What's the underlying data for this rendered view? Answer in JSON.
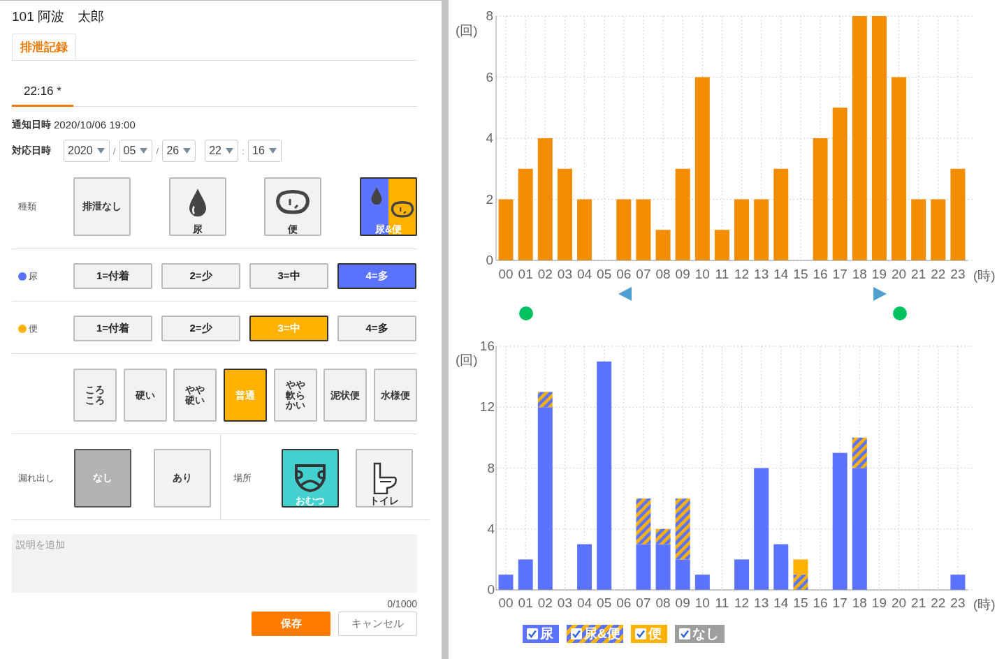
{
  "header": {
    "title": "101  阿波　太郎"
  },
  "tabs": [
    {
      "label": "排泄記録",
      "selected": true
    }
  ],
  "record_tabs": [
    {
      "label": "22:16 *",
      "selected": true
    }
  ],
  "notified": {
    "label": "通知日時",
    "value": "2020/10/06 19:00"
  },
  "handled": {
    "label": "対応日時",
    "selects": [
      {
        "value": "2020"
      },
      {
        "sep": "/",
        "value": "05"
      },
      {
        "sep": "/",
        "value": "26"
      },
      {
        "value": "22"
      },
      {
        "sep": ":",
        "value": "16"
      }
    ]
  },
  "type": {
    "label": "種類",
    "options": [
      {
        "label": "排泄なし",
        "kind": "none",
        "selected": false
      },
      {
        "label": "尿",
        "kind": "urine",
        "selected": false
      },
      {
        "label": "便",
        "kind": "stool",
        "selected": false
      },
      {
        "label": "尿&便",
        "kind": "both",
        "selected": true
      }
    ]
  },
  "urine": {
    "label": "尿",
    "color": "#5b73ff",
    "options": [
      {
        "label": "1=付着",
        "selected": false
      },
      {
        "label": "2=少",
        "selected": false
      },
      {
        "label": "3=中",
        "selected": false
      },
      {
        "label": "4=多",
        "selected": true
      }
    ]
  },
  "stool": {
    "label": "便",
    "color": "#ffb300",
    "options": [
      {
        "label": "1=付着",
        "selected": false
      },
      {
        "label": "2=少",
        "selected": false
      },
      {
        "label": "3=中",
        "selected": true
      },
      {
        "label": "4=多",
        "selected": false
      }
    ]
  },
  "consistency": {
    "options": [
      {
        "label": "ころころ",
        "selected": false
      },
      {
        "label": "硬い",
        "selected": false
      },
      {
        "label": "やや硬い",
        "selected": false
      },
      {
        "label": "普通",
        "selected": true
      },
      {
        "label": "やや軟らかい",
        "selected": false
      },
      {
        "label": "泥状便",
        "selected": false
      },
      {
        "label": "水様便",
        "selected": false
      }
    ]
  },
  "leak": {
    "label": "漏れ出し",
    "options": [
      {
        "label": "なし",
        "selected": true
      },
      {
        "label": "あり",
        "selected": false
      }
    ]
  },
  "place": {
    "label": "場所",
    "options": [
      {
        "label": "おむつ",
        "kind": "diaper",
        "selected": true
      },
      {
        "label": "トイレ",
        "kind": "toilet",
        "selected": false
      }
    ]
  },
  "note": {
    "placeholder": "説明を追加",
    "counter": "0/1000"
  },
  "buttons": [
    {
      "label": "保存",
      "kind": "primary"
    },
    {
      "label": "キャンセル",
      "kind": "secondary"
    }
  ],
  "hourly_chart": {
    "chart_data": {
      "type": "bar",
      "xlabel": "(時)",
      "ylabel": "(回)",
      "categories": [
        "00",
        "01",
        "02",
        "03",
        "04",
        "05",
        "06",
        "07",
        "08",
        "09",
        "10",
        "11",
        "12",
        "13",
        "14",
        "15",
        "16",
        "17",
        "18",
        "19",
        "20",
        "21",
        "22",
        "23"
      ],
      "series": [
        {
          "color": "#f28c00",
          "values": [
            2,
            3,
            4,
            3,
            2,
            0,
            2,
            2,
            1,
            3,
            6,
            1,
            2,
            2,
            3,
            0,
            4,
            5,
            8,
            8,
            6,
            2,
            2,
            3
          ]
        }
      ],
      "ylim": [
        0,
        8
      ],
      "yticks": [
        0,
        2,
        4,
        6,
        8
      ],
      "grid": true
    }
  },
  "type_chart": {
    "chart_data": {
      "type": "bar",
      "stacked": true,
      "xlabel": "(時)",
      "ylabel": "(回)",
      "categories": [
        "00",
        "01",
        "02",
        "03",
        "04",
        "05",
        "06",
        "07",
        "08",
        "09",
        "10",
        "11",
        "12",
        "13",
        "14",
        "15",
        "16",
        "17",
        "18",
        "19",
        "20",
        "21",
        "22",
        "23"
      ],
      "series": [
        {
          "name": "尿",
          "color": "#5b73ff",
          "values": [
            1,
            2,
            12,
            0,
            3,
            15,
            0,
            3,
            3,
            2,
            1,
            0,
            2,
            8,
            3,
            0,
            0,
            9,
            8,
            0,
            0,
            0,
            0,
            1
          ]
        },
        {
          "name": "尿&便",
          "color": "#ffb300",
          "values": [
            0,
            0,
            1,
            0,
            0,
            0,
            0,
            3,
            1,
            4,
            0,
            0,
            0,
            0,
            0,
            1,
            0,
            0,
            2,
            0,
            0,
            0,
            0,
            0
          ]
        },
        {
          "name": "便",
          "color": "#ffb300",
          "values": [
            0,
            0,
            0,
            0,
            0,
            0,
            0,
            0,
            0,
            0,
            0,
            0,
            0,
            0,
            0,
            1,
            0,
            0,
            0,
            0,
            0,
            0,
            0,
            0
          ]
        },
        {
          "name": "なし",
          "color": "#9e9e9e",
          "values": [
            0,
            0,
            0,
            0,
            0,
            0,
            0,
            0,
            0,
            0,
            0,
            0,
            0,
            0,
            0,
            0,
            0,
            0,
            0,
            0,
            0,
            0,
            0,
            0
          ]
        }
      ],
      "ylim": [
        0,
        16
      ],
      "yticks": [
        0,
        4,
        8,
        12,
        16
      ],
      "grid": true
    },
    "legend": [
      {
        "kind": "solid",
        "checked": true
      },
      {
        "kind": "striped",
        "checked": true
      },
      {
        "kind": "solid",
        "checked": true
      },
      {
        "kind": "solid",
        "checked": true
      }
    ]
  }
}
